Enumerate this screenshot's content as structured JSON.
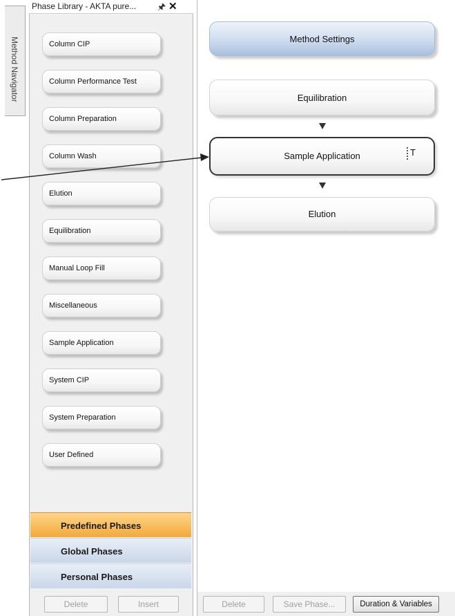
{
  "navigator": {
    "tab_label": "Method Navigator"
  },
  "phase_library": {
    "title": "Phase Library - AKTA pure...",
    "phases": [
      "Column CIP",
      "Column Performance Test",
      "Column Preparation",
      "Column Wash",
      "Elution",
      "Equilibration",
      "Manual Loop Fill",
      "Miscellaneous",
      "Sample Application",
      "System CIP",
      "System Preparation",
      "User Defined"
    ],
    "categories": {
      "predefined": "Predefined Phases",
      "global": "Global Phases",
      "personal": "Personal Phases"
    },
    "buttons": {
      "delete": "Delete",
      "insert": "Insert"
    }
  },
  "method": {
    "settings_label": "Method Settings",
    "phases": [
      "Equilibration",
      "Sample Application",
      "Elution"
    ],
    "sample_app_marker": "T",
    "buttons": {
      "delete": "Delete",
      "save_phase": "Save Phase...",
      "duration_variables": "Duration & Variables"
    }
  },
  "colors": {
    "predefined_accent": "#f3a93a",
    "method_settings_accent": "#a9c0df",
    "category_blue": "#c9d7ea"
  },
  "icons": {
    "pin": "pin-icon",
    "close": "close-icon"
  }
}
